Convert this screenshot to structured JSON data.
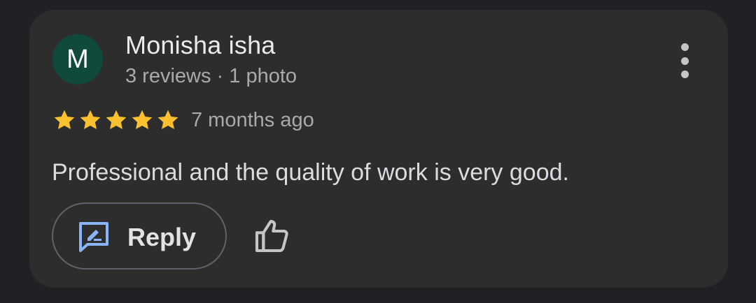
{
  "review": {
    "avatar_letter": "M",
    "author_name": "Monisha isha",
    "author_meta": "3 reviews · 1 photo",
    "rating": 5,
    "rating_max": 5,
    "time_ago": "7 months ago",
    "text": "Professional and the quality of work is very good."
  },
  "actions": {
    "reply_label": "Reply"
  },
  "icons": {
    "more": "more-vert-icon",
    "star": "star-icon",
    "reply": "rate-review-icon",
    "like": "thumb-up-icon"
  },
  "colors": {
    "background": "#202124",
    "card": "#2d2d2e",
    "avatar": "#0f4a3c",
    "star": "#fbc02d",
    "reply_icon": "#8ab4f8"
  }
}
